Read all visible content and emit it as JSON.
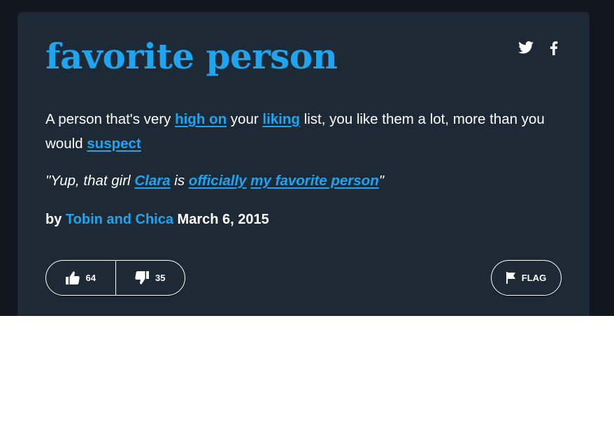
{
  "definition": {
    "word": "favorite person",
    "meaning": {
      "t1": "A person that's very ",
      "l1": "high on",
      "t2": " your ",
      "l2": "liking",
      "t3": " list, you like them a lot, more than you would ",
      "l3": "suspect"
    },
    "example": {
      "t1": "\"Yup, that girl ",
      "l1": "Clara",
      "t2": " is ",
      "l2": "officially",
      "t3": " ",
      "l3": "my favorite person",
      "t4": "\""
    },
    "contributor": {
      "by": "by ",
      "author": "Tobin and Chica",
      "date": " March 6, 2015"
    }
  },
  "share": {
    "twitter_icon": "twitter-bird-icon",
    "facebook_icon": "facebook-f-icon"
  },
  "votes": {
    "up": "64",
    "down": "35",
    "up_icon": "thumbs-up-icon",
    "down_icon": "thumbs-down-icon"
  },
  "flag": {
    "label": "FLAG",
    "icon": "flag-icon"
  },
  "colors": {
    "background": "#11161f",
    "card": "#1d2a36",
    "accent": "#1fa4f0",
    "text": "#ffffff"
  }
}
